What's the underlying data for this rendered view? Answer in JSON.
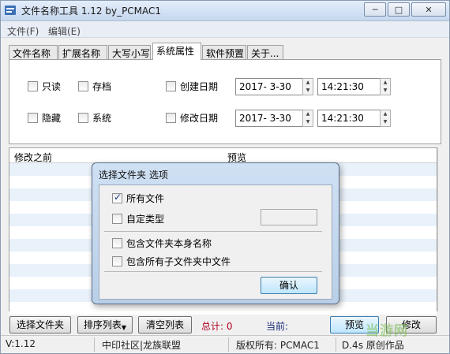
{
  "window": {
    "title": "文件名称工具 1.12   by_PCMAC1",
    "icon": "app-icon",
    "buttons": {
      "minimize": "─",
      "maximize": "□",
      "close": "✕"
    }
  },
  "menu": [
    "文件(F)",
    "编辑(E)"
  ],
  "tabs": [
    {
      "label": "文件名称",
      "active": false
    },
    {
      "label": "扩展名称",
      "active": false
    },
    {
      "label": "大写小写",
      "active": false
    },
    {
      "label": "系统属性",
      "active": true
    },
    {
      "label": "软件预置",
      "active": false
    },
    {
      "label": "关于...",
      "active": false
    }
  ],
  "attributes": {
    "readonly": {
      "label": "只读",
      "checked": false
    },
    "archive": {
      "label": "存档",
      "checked": false
    },
    "hidden": {
      "label": "隐藏",
      "checked": false
    },
    "system": {
      "label": "系统",
      "checked": false
    },
    "created": {
      "label": "创建日期",
      "checked": false,
      "date": "2017-  3-30",
      "time": "14:21:30"
    },
    "modified": {
      "label": "修改日期",
      "checked": false,
      "date": "2017-  3-30",
      "time": "14:21:30"
    }
  },
  "list": {
    "columns": [
      "修改之前",
      "预览"
    ]
  },
  "buttons": {
    "select_folder": "选择文件夹",
    "sort_list": "排序列表",
    "clear_list": "清空列表",
    "preview": "预览",
    "modify": "修改"
  },
  "stats": {
    "total": "总计: 0",
    "current": "当前:"
  },
  "statusbar": {
    "version": "V:1.12",
    "community": "中印社区|龙族联盟",
    "copyright": "版权所有: PCMAC1",
    "credit": "D.4s  原创作品"
  },
  "dialog": {
    "title": "选择文件夹 选项",
    "all_files": {
      "label": "所有文件",
      "checked": true
    },
    "custom_type": {
      "label": "自定类型",
      "checked": false,
      "value": ""
    },
    "include_folder_name": {
      "label": "包含文件夹本身名称",
      "checked": false
    },
    "include_subfolder_files": {
      "label": "包含所有子文件夹中文件",
      "checked": false
    },
    "ok": "确认"
  },
  "watermark": "当游网",
  "colors": {
    "accent": "#3c7fb1",
    "total_text": "#b00020",
    "watermark": "#78be50"
  }
}
